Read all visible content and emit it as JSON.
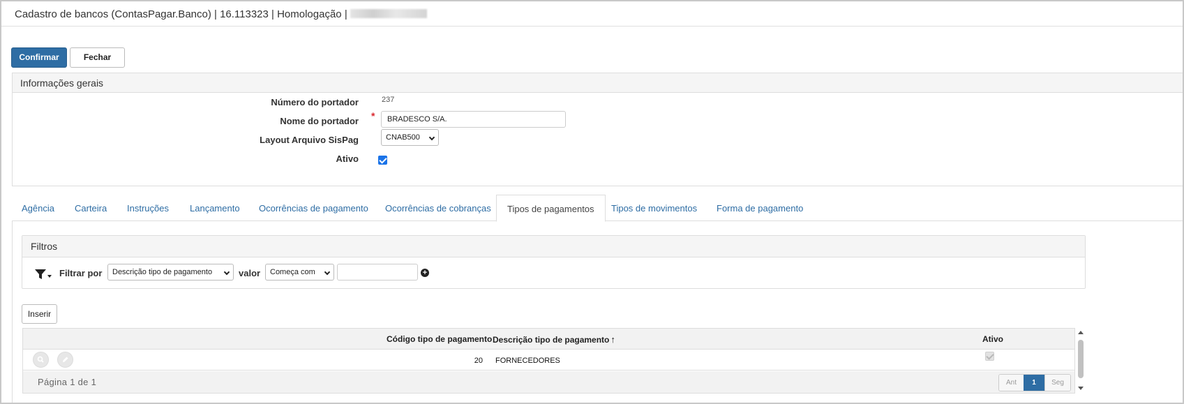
{
  "window": {
    "title": "Cadastro de bancos (ContasPagar.Banco) | 16.113323 | Homologação |"
  },
  "toolbar": {
    "confirm_label": "Confirmar",
    "close_label": "Fechar"
  },
  "general_info": {
    "heading": "Informações gerais",
    "fields": {
      "numero_label": "Número do portador",
      "numero_value": "237",
      "nome_label": "Nome do portador",
      "nome_value": "BRADESCO S/A.",
      "layout_label": "Layout Arquivo SisPag",
      "layout_value": "CNAB500",
      "ativo_label": "Ativo",
      "ativo_checked": true
    }
  },
  "tabs": [
    {
      "label": "Agência"
    },
    {
      "label": "Carteira"
    },
    {
      "label": "Instruções"
    },
    {
      "label": "Lançamento"
    },
    {
      "label": "Ocorrências de pagamento"
    },
    {
      "label": "Ocorrências de cobranças"
    },
    {
      "label": "Tipos de pagamentos",
      "active": true
    },
    {
      "label": "Tipos de movimentos"
    },
    {
      "label": "Forma de pagamento"
    }
  ],
  "filters": {
    "heading": "Filtros",
    "filter_by_label": "Filtrar por",
    "field_select": "Descrição tipo de pagamento",
    "value_label": "valor",
    "operator_select": "Começa com",
    "value_input": ""
  },
  "grid": {
    "insert_label": "Inserir",
    "columns": {
      "codigo": "Código tipo de pagamento",
      "descricao": "Descrição tipo de pagamento",
      "ativo": "Ativo"
    },
    "sort_icon": "↑",
    "rows": [
      {
        "codigo": "20",
        "descricao": "FORNECEDORES",
        "ativo": true
      }
    ],
    "footer": {
      "page_label": "Página 1 de 1",
      "prev": "Ant",
      "current": "1",
      "next": "Seg"
    }
  },
  "icons": {
    "filter": "funnel-icon",
    "add": "plus-circle-icon",
    "view": "magnifier-icon",
    "edit": "pencil-icon"
  },
  "colors": {
    "primary": "#2e6da4",
    "link": "#2e6da4",
    "required": "#d9282f"
  }
}
